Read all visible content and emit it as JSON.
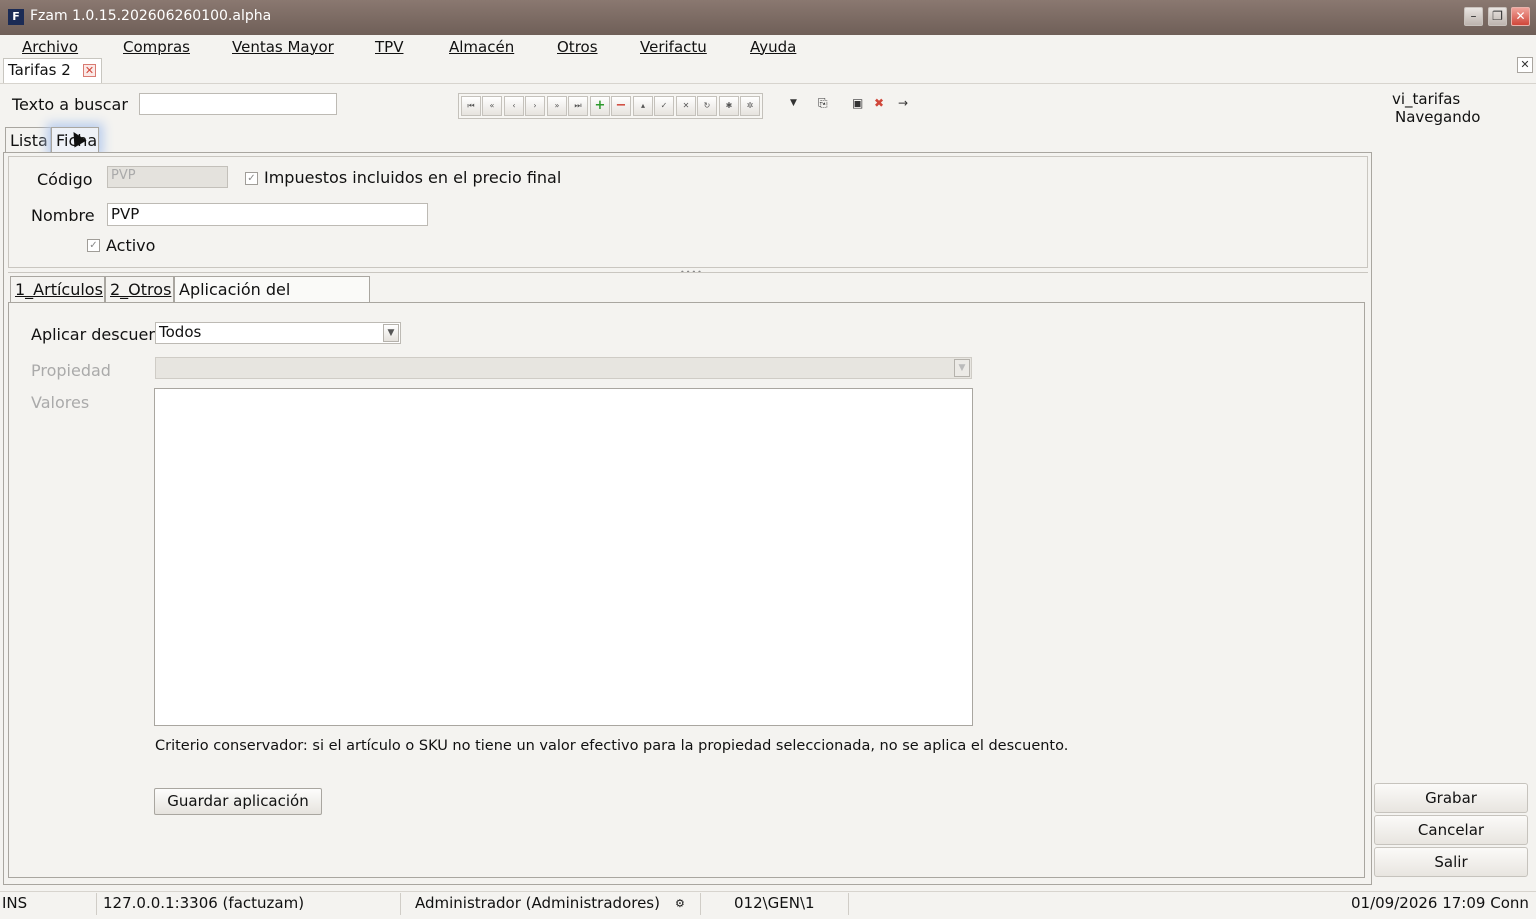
{
  "window": {
    "title": "Fzam 1.0.15.202606260100.alpha",
    "app_icon_letter": "F"
  },
  "menu": [
    "Archivo",
    "Compras",
    "Ventas Mayor",
    "TPV",
    "Almacén",
    "Otros",
    "Verifactu",
    "Ayuda"
  ],
  "document_tab": {
    "label": "Tarifas 2"
  },
  "search": {
    "label": "Texto a buscar",
    "value": ""
  },
  "navigator": {
    "buttons": [
      "first",
      "prev-page",
      "prev",
      "next",
      "next-page",
      "last",
      "add",
      "delete",
      "edit",
      "confirm",
      "cancel",
      "refresh",
      "bookmark",
      "filter"
    ],
    "icons": [
      "dropdown-arrow-icon",
      "copy-icon",
      "export-icon",
      "close-x-icon",
      "arrow-right-icon"
    ]
  },
  "view": {
    "name": "vi_tarifas",
    "status": "Navegando"
  },
  "main_tabs": [
    "Lista",
    "Ficha"
  ],
  "ficha": {
    "codigo_label": "Código",
    "codigo_value": "PVP",
    "impuestos_label": "Impuestos incluidos en el precio final",
    "impuestos_checked": true,
    "nombre_label": "Nombre",
    "nombre_value": "PVP",
    "activo_label": "Activo",
    "activo_checked": true
  },
  "sub_tabs": [
    "1_Artículos",
    "2_Otros",
    "Aplicación del descuento"
  ],
  "aplicacion": {
    "aplicar_label": "Aplicar descuent",
    "aplicar_value": "Todos",
    "propiedad_label": "Propiedad",
    "propiedad_value": "",
    "valores_label": "Valores",
    "note": "Criterio conservador: si el artículo o SKU no tiene un valor efectivo para la propiedad seleccionada, no se aplica el descuento.",
    "guardar_label": "Guardar aplicación"
  },
  "side_buttons": [
    "Grabar",
    "Cancelar",
    "Salir"
  ],
  "status": {
    "mode": "INS",
    "connection": "127.0.0.1:3306 (factuzam)",
    "user": "Administrador (Administradores)",
    "path": "012\\GEN\\1",
    "datetime": "01/09/2026 17:09 Conn"
  },
  "colors": {
    "titlebar": "#7a6a62",
    "close_button": "#d0473a",
    "add_icon": "#2e9a2e",
    "delete_icon": "#d0473a"
  }
}
